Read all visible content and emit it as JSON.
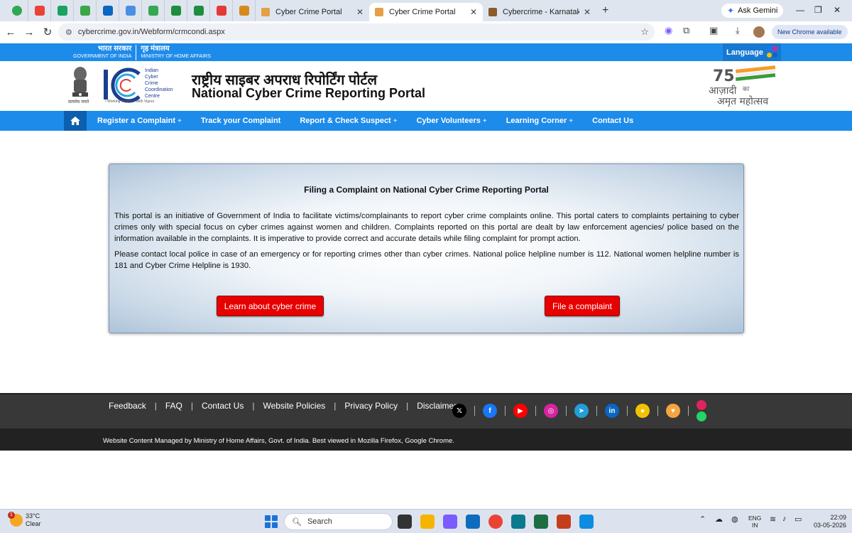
{
  "browser": {
    "tabs": [
      {
        "title": "Cyber Crime Portal",
        "active": false
      },
      {
        "title": "Cyber Crime Portal",
        "active": true
      },
      {
        "title": "Cybercrime - Karnataka State P",
        "active": false
      }
    ],
    "new_tab": "+",
    "ask_gemini": "Ask Gemini",
    "url": "cybercrime.gov.in/Webform/crmcondi.aspx",
    "update_label": "New Chrome available",
    "bookmark_icon_colors": [
      "#2fa84f",
      "#ea4335",
      "#1aa260",
      "#3ca64a",
      "#0a66c2",
      "#4a90e2",
      "#34a853",
      "#1e8e3e",
      "#1e8e3e",
      "#e53935",
      "#d58a1f"
    ]
  },
  "gov_strip": {
    "hindi_gov": "भारत सरकार",
    "english_gov": "GOVERNMENT OF INDIA",
    "hindi_ministry": "गृह मंत्रालय",
    "english_ministry": "MINISTRY OF HOME AFFAIRS",
    "language_label": "Language"
  },
  "header": {
    "emblem_motto": "सत्यमेव जयते",
    "i4c_words": [
      "Indian",
      "Cyber",
      "Crime",
      "Coordination",
      "Centre"
    ],
    "i4c_motto": "• Working Together With Vigour",
    "title_hindi": "राष्ट्रीय साइबर अपराध रिपोर्टिंग पोर्टल",
    "title_english": "National Cyber Crime Reporting Portal",
    "azadi_top": "आज़ादी",
    "azadi_ka": "का",
    "azadi_bottom": "अमृत महोत्सव"
  },
  "nav": {
    "items": [
      {
        "label": "Register a Complaint",
        "has_sub": true
      },
      {
        "label": "Track your Complaint",
        "has_sub": false
      },
      {
        "label": "Report & Check Suspect",
        "has_sub": true
      },
      {
        "label": "Cyber Volunteers",
        "has_sub": true
      },
      {
        "label": "Learning Corner",
        "has_sub": true
      },
      {
        "label": "Contact Us",
        "has_sub": false
      }
    ],
    "plus_symbol": "+"
  },
  "card": {
    "title": "Filing a Complaint on National Cyber Crime Reporting Portal",
    "paragraph1": "This portal is an initiative of Government of India to facilitate victims/complainants to report cyber crime complaints online. This portal caters to complaints pertaining to cyber crimes only with special focus on cyber crimes against women and children. Complaints reported on this portal are dealt by law enforcement agencies/ police based on the information available in the complaints. It is imperative to provide correct and accurate details while filing complaint for prompt action.",
    "paragraph2": "Please contact local police in case of an emergency or for reporting crimes other than cyber crimes. National police helpline number is 112. National women helpline number is 181 and Cyber Crime Helpline is 1930.",
    "learn_button": "Learn about cyber crime",
    "file_button": "File a complaint"
  },
  "footer": {
    "links": [
      "Feedback",
      "FAQ",
      "Contact Us",
      "Website Policies",
      "Privacy Policy",
      "Disclaimer"
    ],
    "separator": "|",
    "social": [
      {
        "name": "x-icon",
        "glyph": "𝕏",
        "color": "#000000"
      },
      {
        "name": "facebook-icon",
        "glyph": "f",
        "color": "#1877f2"
      },
      {
        "name": "youtube-icon",
        "glyph": "▶",
        "color": "#ff0000"
      },
      {
        "name": "instagram-icon",
        "glyph": "◎",
        "color": "#d6249f"
      },
      {
        "name": "telegram-icon",
        "glyph": "➤",
        "color": "#229ed9"
      },
      {
        "name": "linkedin-icon",
        "glyph": "in",
        "color": "#0a66c2"
      },
      {
        "name": "koo-icon",
        "glyph": "●",
        "color": "#f2c200"
      },
      {
        "name": "sharechat-icon",
        "glyph": "♥",
        "color": "#f7a440"
      }
    ],
    "note": "Website Content Managed by Ministry of Home Affairs, Govt. of India. Best viewed in Mozilla Firefox, Google Chrome."
  },
  "taskbar": {
    "weather_badge": "1",
    "temperature": "33°C",
    "weather": "Clear",
    "search_placeholder": "Search",
    "lang_line1": "ENG",
    "lang_line2": "IN",
    "time": "22:09",
    "date": "03-05-2026",
    "app_colors": [
      "#333333",
      "#f4b400",
      "#7b5cff",
      "#0f6cbd",
      "#ea4335",
      "#0b7a8c",
      "#1d6f42",
      "#c43e1c",
      "#0c8de0"
    ]
  }
}
